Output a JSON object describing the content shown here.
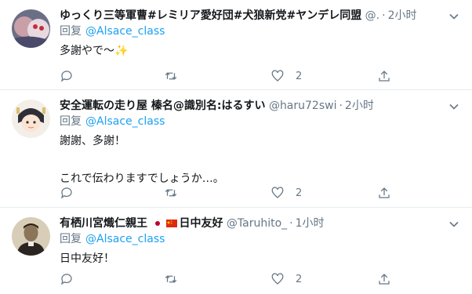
{
  "tweets": [
    {
      "name": "ゆっくり三等軍曹#レミリア愛好団#犬狼新党#ヤンデレ同盟",
      "handle": "@.",
      "time": "2小时",
      "reply_label": "回复",
      "reply_to": "@Alsace_class",
      "text": "多謝やで～✨",
      "reply_count": "",
      "retweet_count": "",
      "like_count": "2",
      "avatar_icon": "anime-character-avatar"
    },
    {
      "name": "安全運転の走り屋 榛名@識別名:はるすい",
      "handle": "@haru72swi",
      "time": "2小时",
      "reply_label": "回复",
      "reply_to": "@Alsace_class",
      "text": "謝謝、多謝！\n\nこれで伝わりますでしょうか…。",
      "reply_count": "",
      "retweet_count": "",
      "like_count": "2",
      "avatar_icon": "anime-girl-avatar"
    },
    {
      "name": "有栖川宮熾仁親王",
      "flags": [
        "japan-flag-icon",
        "china-flag-icon"
      ],
      "name_suffix": "日中友好",
      "handle": "@Taruhito_",
      "time": "1小时",
      "reply_label": "回复",
      "reply_to": "@Alsace_class",
      "text": "日中友好！",
      "reply_count": "",
      "retweet_count": "",
      "like_count": "2",
      "avatar_icon": "historical-portrait-avatar"
    }
  ],
  "colors": {
    "link": "#1da1f2",
    "secondary": "#657786",
    "text": "#14171a",
    "divider": "#e6ecf0"
  }
}
